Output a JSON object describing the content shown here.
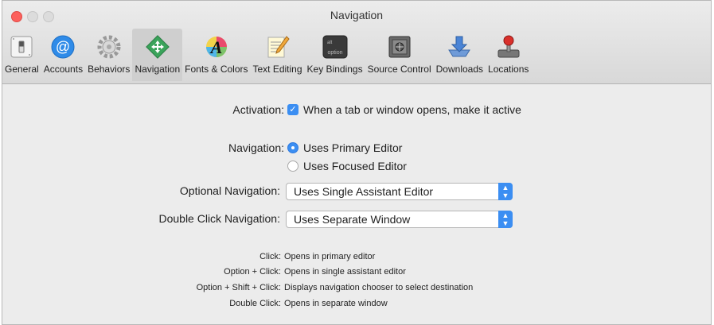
{
  "window": {
    "title": "Navigation"
  },
  "toolbar": {
    "items": [
      {
        "label": "General"
      },
      {
        "label": "Accounts"
      },
      {
        "label": "Behaviors"
      },
      {
        "label": "Navigation"
      },
      {
        "label": "Fonts & Colors"
      },
      {
        "label": "Text Editing"
      },
      {
        "label": "Key Bindings"
      },
      {
        "label": "Source Control"
      },
      {
        "label": "Downloads"
      },
      {
        "label": "Locations"
      }
    ],
    "selected": "Navigation"
  },
  "activation": {
    "label": "Activation:",
    "checkbox_text": "When a tab or window opens, make it active",
    "checked": true
  },
  "navigation": {
    "label": "Navigation:",
    "options": [
      "Uses Primary Editor",
      "Uses Focused Editor"
    ],
    "selected": "Uses Primary Editor"
  },
  "optional_navigation": {
    "label": "Optional Navigation:",
    "value": "Uses Single Assistant Editor"
  },
  "double_click_navigation": {
    "label": "Double Click Navigation:",
    "value": "Uses Separate Window"
  },
  "hints": [
    {
      "key": "Click:",
      "value": "Opens in primary editor"
    },
    {
      "key": "Option + Click:",
      "value": "Opens in single assistant editor"
    },
    {
      "key": "Option + Shift + Click:",
      "value": "Displays navigation chooser to select destination"
    },
    {
      "key": "Double Click:",
      "value": "Opens in separate window"
    }
  ],
  "icons": {
    "general": "switch-icon",
    "accounts": "at-sign-icon",
    "behaviors": "gear-icon",
    "navigation": "move-arrows-icon",
    "fonts": "font-a-icon",
    "text": "notepad-pencil-icon",
    "keys": "option-key-icon",
    "source": "vault-icon",
    "downloads": "download-tray-icon",
    "locations": "joystick-icon"
  },
  "accent_color": "#3b8ef2",
  "key_label": "option"
}
